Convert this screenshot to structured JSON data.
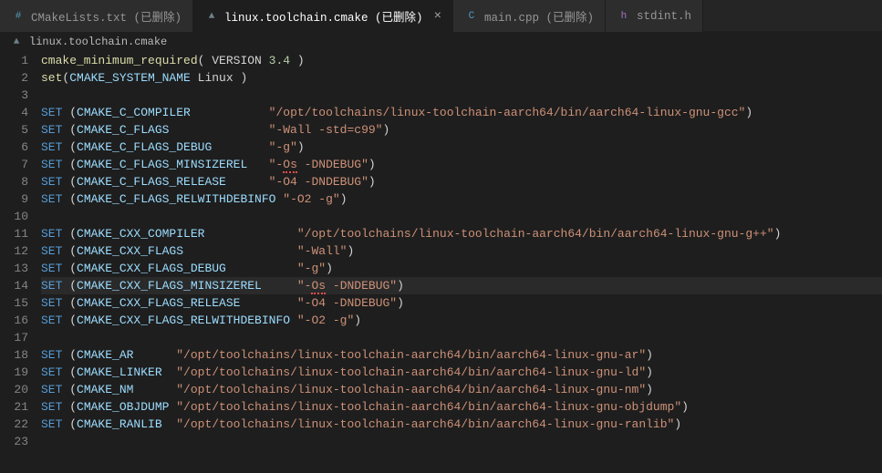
{
  "tabs": [
    {
      "label": "CMakeLists.txt (已删除)",
      "icon": "#",
      "iconColor": "#519aba",
      "active": false,
      "close": false
    },
    {
      "label": "linux.toolchain.cmake (已删除)",
      "icon": "▲",
      "iconColor": "#6d8086",
      "active": true,
      "close": true
    },
    {
      "label": "main.cpp (已删除)",
      "icon": "C",
      "iconColor": "#519aba",
      "active": false,
      "close": false
    },
    {
      "label": "stdint.h",
      "icon": "h",
      "iconColor": "#a074c4",
      "active": false,
      "close": false
    }
  ],
  "breadcrumb": {
    "icon": "▲",
    "iconColor": "#6d8086",
    "label": "linux.toolchain.cmake"
  },
  "currentLine": 14,
  "code": [
    {
      "n": 1,
      "tokens": [
        {
          "t": "cmake_minimum_required",
          "c": "func"
        },
        {
          "t": "( VERSION ",
          "c": ""
        },
        {
          "t": "3.4",
          "c": "num"
        },
        {
          "t": " )",
          "c": ""
        }
      ]
    },
    {
      "n": 2,
      "tokens": [
        {
          "t": "set",
          "c": "func"
        },
        {
          "t": "(",
          "c": ""
        },
        {
          "t": "CMAKE_SYSTEM_NAME",
          "c": "var"
        },
        {
          "t": " Linux )",
          "c": ""
        }
      ]
    },
    {
      "n": 3,
      "tokens": []
    },
    {
      "n": 4,
      "tokens": [
        {
          "t": "SET",
          "c": "keyword"
        },
        {
          "t": " (",
          "c": ""
        },
        {
          "t": "CMAKE_C_COMPILER",
          "c": "var"
        },
        {
          "t": "           ",
          "c": ""
        },
        {
          "t": "\"/opt/toolchains/linux-toolchain-aarch64/bin/aarch64-linux-gnu-gcc\"",
          "c": "string"
        },
        {
          "t": ")",
          "c": ""
        }
      ]
    },
    {
      "n": 5,
      "tokens": [
        {
          "t": "SET",
          "c": "keyword"
        },
        {
          "t": " (",
          "c": ""
        },
        {
          "t": "CMAKE_C_FLAGS",
          "c": "var"
        },
        {
          "t": "              ",
          "c": ""
        },
        {
          "t": "\"-Wall -std=c99\"",
          "c": "string"
        },
        {
          "t": ")",
          "c": ""
        }
      ]
    },
    {
      "n": 6,
      "tokens": [
        {
          "t": "SET",
          "c": "keyword"
        },
        {
          "t": " (",
          "c": ""
        },
        {
          "t": "CMAKE_C_FLAGS_DEBUG",
          "c": "var"
        },
        {
          "t": "        ",
          "c": ""
        },
        {
          "t": "\"-g\"",
          "c": "string"
        },
        {
          "t": ")",
          "c": ""
        }
      ]
    },
    {
      "n": 7,
      "tokens": [
        {
          "t": "SET",
          "c": "keyword"
        },
        {
          "t": " (",
          "c": ""
        },
        {
          "t": "CMAKE_C_FLAGS_MINSIZEREL",
          "c": "var"
        },
        {
          "t": "   ",
          "c": ""
        },
        {
          "t": "\"-",
          "c": "string"
        },
        {
          "t": "Os",
          "c": "string err"
        },
        {
          "t": " -DNDEBUG\"",
          "c": "string"
        },
        {
          "t": ")",
          "c": ""
        }
      ]
    },
    {
      "n": 8,
      "tokens": [
        {
          "t": "SET",
          "c": "keyword"
        },
        {
          "t": " (",
          "c": ""
        },
        {
          "t": "CMAKE_C_FLAGS_RELEASE",
          "c": "var"
        },
        {
          "t": "      ",
          "c": ""
        },
        {
          "t": "\"-O4 -DNDEBUG\"",
          "c": "string"
        },
        {
          "t": ")",
          "c": ""
        }
      ]
    },
    {
      "n": 9,
      "tokens": [
        {
          "t": "SET",
          "c": "keyword"
        },
        {
          "t": " (",
          "c": ""
        },
        {
          "t": "CMAKE_C_FLAGS_RELWITHDEBINFO",
          "c": "var"
        },
        {
          "t": " ",
          "c": ""
        },
        {
          "t": "\"-O2 -g\"",
          "c": "string"
        },
        {
          "t": ")",
          "c": ""
        }
      ]
    },
    {
      "n": 10,
      "tokens": []
    },
    {
      "n": 11,
      "tokens": [
        {
          "t": "SET",
          "c": "keyword"
        },
        {
          "t": " (",
          "c": ""
        },
        {
          "t": "CMAKE_CXX_COMPILER",
          "c": "var"
        },
        {
          "t": "             ",
          "c": ""
        },
        {
          "t": "\"/opt/toolchains/linux-toolchain-aarch64/bin/aarch64-linux-gnu-g++\"",
          "c": "string"
        },
        {
          "t": ")",
          "c": ""
        }
      ]
    },
    {
      "n": 12,
      "tokens": [
        {
          "t": "SET",
          "c": "keyword"
        },
        {
          "t": " (",
          "c": ""
        },
        {
          "t": "CMAKE_CXX_FLAGS",
          "c": "var"
        },
        {
          "t": "                ",
          "c": ""
        },
        {
          "t": "\"-Wall\"",
          "c": "string"
        },
        {
          "t": ")",
          "c": ""
        }
      ]
    },
    {
      "n": 13,
      "tokens": [
        {
          "t": "SET",
          "c": "keyword"
        },
        {
          "t": " (",
          "c": ""
        },
        {
          "t": "CMAKE_CXX_FLAGS_DEBUG",
          "c": "var"
        },
        {
          "t": "          ",
          "c": ""
        },
        {
          "t": "\"-g\"",
          "c": "string"
        },
        {
          "t": ")",
          "c": ""
        }
      ]
    },
    {
      "n": 14,
      "tokens": [
        {
          "t": "SET",
          "c": "keyword"
        },
        {
          "t": " (",
          "c": ""
        },
        {
          "t": "CMAKE_CXX_FLAGS_MINSIZEREL",
          "c": "var"
        },
        {
          "t": "     ",
          "c": ""
        },
        {
          "t": "\"-",
          "c": "string"
        },
        {
          "t": "Os",
          "c": "string err"
        },
        {
          "t": " -DNDEBUG\"",
          "c": "string"
        },
        {
          "t": ")",
          "c": ""
        }
      ]
    },
    {
      "n": 15,
      "tokens": [
        {
          "t": "SET",
          "c": "keyword"
        },
        {
          "t": " (",
          "c": ""
        },
        {
          "t": "CMAKE_CXX_FLAGS_RELEASE",
          "c": "var"
        },
        {
          "t": "        ",
          "c": ""
        },
        {
          "t": "\"-O4 -DNDEBUG\"",
          "c": "string"
        },
        {
          "t": ")",
          "c": ""
        }
      ]
    },
    {
      "n": 16,
      "tokens": [
        {
          "t": "SET",
          "c": "keyword"
        },
        {
          "t": " (",
          "c": ""
        },
        {
          "t": "CMAKE_CXX_FLAGS_RELWITHDEBINFO",
          "c": "var"
        },
        {
          "t": " ",
          "c": ""
        },
        {
          "t": "\"-O2 -g\"",
          "c": "string"
        },
        {
          "t": ")",
          "c": ""
        }
      ]
    },
    {
      "n": 17,
      "tokens": []
    },
    {
      "n": 18,
      "tokens": [
        {
          "t": "SET",
          "c": "keyword"
        },
        {
          "t": " (",
          "c": ""
        },
        {
          "t": "CMAKE_AR",
          "c": "var"
        },
        {
          "t": "      ",
          "c": ""
        },
        {
          "t": "\"/opt/toolchains/linux-toolchain-aarch64/bin/aarch64-linux-gnu-ar\"",
          "c": "string"
        },
        {
          "t": ")",
          "c": ""
        }
      ]
    },
    {
      "n": 19,
      "tokens": [
        {
          "t": "SET",
          "c": "keyword"
        },
        {
          "t": " (",
          "c": ""
        },
        {
          "t": "CMAKE_LINKER",
          "c": "var"
        },
        {
          "t": "  ",
          "c": ""
        },
        {
          "t": "\"/opt/toolchains/linux-toolchain-aarch64/bin/aarch64-linux-gnu-ld\"",
          "c": "string"
        },
        {
          "t": ")",
          "c": ""
        }
      ]
    },
    {
      "n": 20,
      "tokens": [
        {
          "t": "SET",
          "c": "keyword"
        },
        {
          "t": " (",
          "c": ""
        },
        {
          "t": "CMAKE_NM",
          "c": "var"
        },
        {
          "t": "      ",
          "c": ""
        },
        {
          "t": "\"/opt/toolchains/linux-toolchain-aarch64/bin/aarch64-linux-gnu-nm\"",
          "c": "string"
        },
        {
          "t": ")",
          "c": ""
        }
      ]
    },
    {
      "n": 21,
      "tokens": [
        {
          "t": "SET",
          "c": "keyword"
        },
        {
          "t": " (",
          "c": ""
        },
        {
          "t": "CMAKE_OBJDUMP",
          "c": "var"
        },
        {
          "t": " ",
          "c": ""
        },
        {
          "t": "\"/opt/toolchains/linux-toolchain-aarch64/bin/aarch64-linux-gnu-objdump\"",
          "c": "string"
        },
        {
          "t": ")",
          "c": ""
        }
      ]
    },
    {
      "n": 22,
      "tokens": [
        {
          "t": "SET",
          "c": "keyword"
        },
        {
          "t": " (",
          "c": ""
        },
        {
          "t": "CMAKE_RANLIB",
          "c": "var"
        },
        {
          "t": "  ",
          "c": ""
        },
        {
          "t": "\"/opt/toolchains/linux-toolchain-aarch64/bin/aarch64-linux-gnu-ranlib\"",
          "c": "string"
        },
        {
          "t": ")",
          "c": ""
        }
      ]
    },
    {
      "n": 23,
      "tokens": []
    }
  ]
}
